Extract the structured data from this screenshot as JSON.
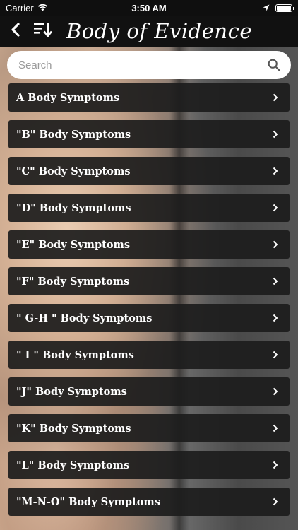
{
  "status_bar": {
    "carrier": "Carrier",
    "time": "3:50 AM"
  },
  "nav": {
    "title": "Body of Evidence"
  },
  "search": {
    "placeholder": "Search"
  },
  "items": [
    {
      "label": "A Body Symptoms"
    },
    {
      "label": "\"B\" Body Symptoms"
    },
    {
      "label": "\"C\" Body Symptoms"
    },
    {
      "label": "\"D\" Body Symptoms"
    },
    {
      "label": "\"E\" Body Symptoms"
    },
    {
      "label": "\"F\" Body Symptoms"
    },
    {
      "label": "\" G-H \" Body Symptoms"
    },
    {
      "label": "\" I \" Body Symptoms"
    },
    {
      "label": "\"J\" Body Symptoms"
    },
    {
      "label": "\"K\" Body Symptoms"
    },
    {
      "label": "\"L\" Body Symptoms"
    },
    {
      "label": "\"M-N-O\" Body Symptoms"
    }
  ],
  "icons": {
    "back": "chevron-left-icon",
    "sort": "sort-descending-icon",
    "search": "search-icon",
    "row_chevron": "chevron-right-icon",
    "wifi": "wifi-icon",
    "location": "location-arrow-icon",
    "battery": "battery-icon"
  },
  "colors": {
    "nav_bg": "#111111",
    "row_bg": "#1c1c1c",
    "text": "#ffffff"
  }
}
